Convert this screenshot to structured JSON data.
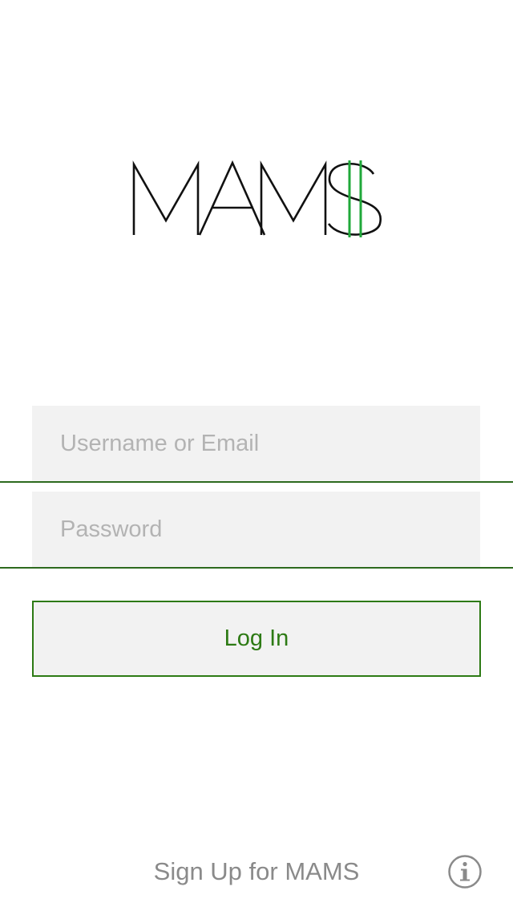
{
  "app": {
    "logo_text": "MAM$",
    "logo_icon": "mams-dollar-logo",
    "brand_color": "#2d7a14",
    "logo_accent_color": "#1fa83a"
  },
  "login_form": {
    "username_placeholder": "Username or Email",
    "username_value": "",
    "password_placeholder": "Password",
    "password_value": "",
    "login_label": "Log In"
  },
  "footer": {
    "signup_label": "Sign Up for MAMS",
    "info_icon": "info-icon"
  }
}
